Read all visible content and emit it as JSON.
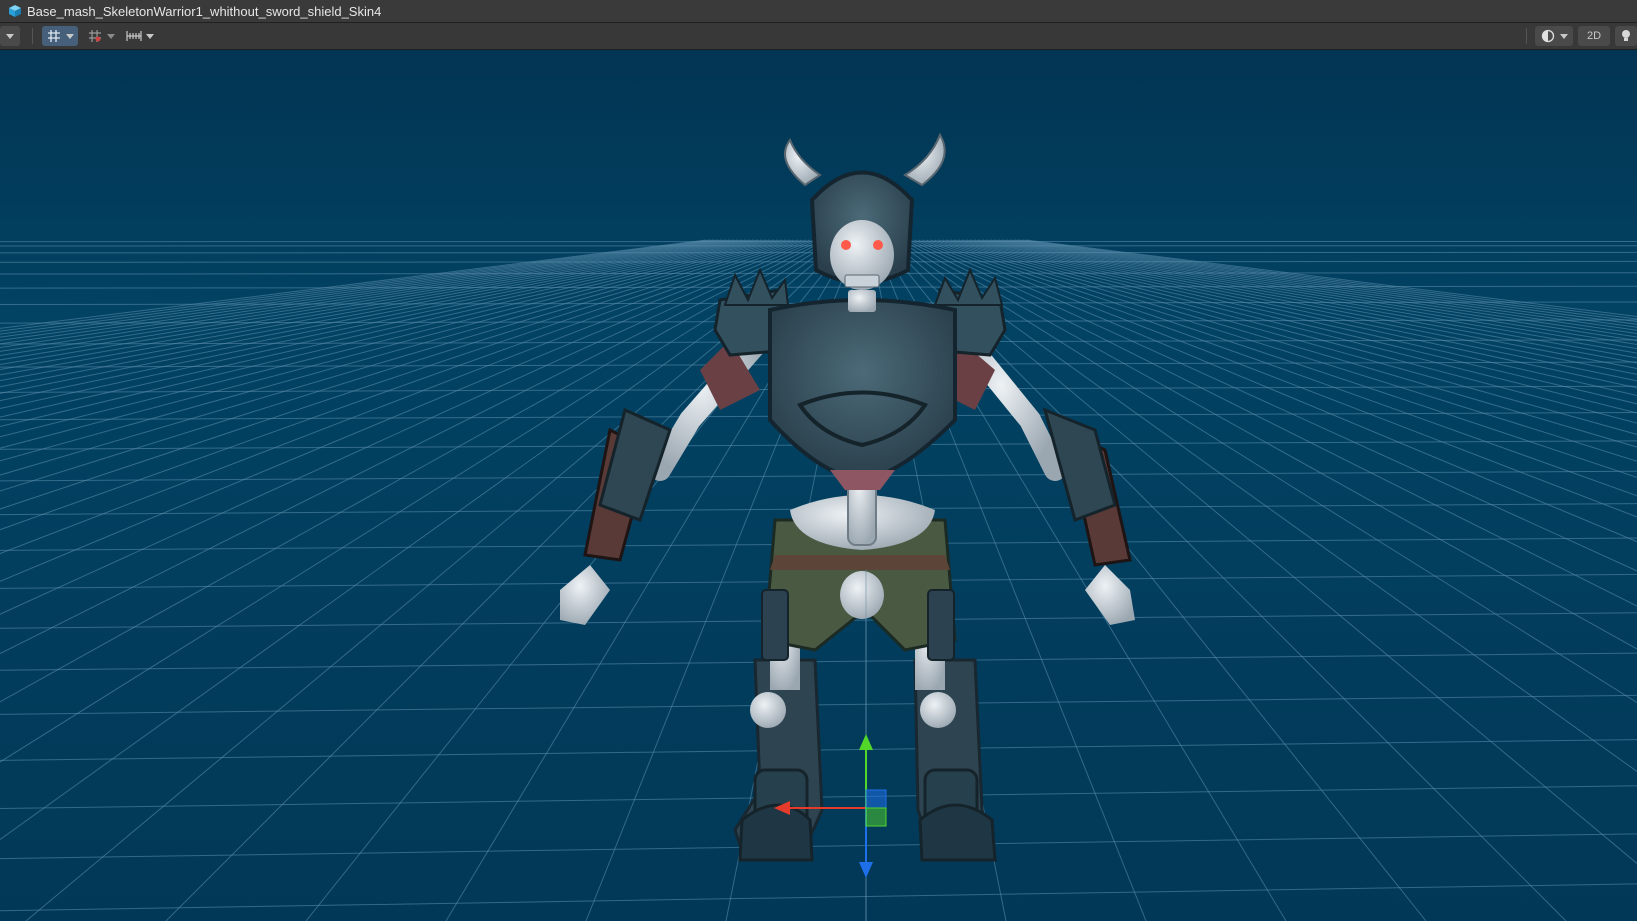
{
  "window": {
    "title": "Base_mash_SkeletonWarrior1_whithout_sword_shield_Skin4"
  },
  "toolbar": {
    "label_2d": "2D",
    "icons": [
      "tool-dropdown-icon",
      "grid-snap-icon",
      "increment-snap-icon",
      "ruler-icon",
      "shading-mode-icon",
      "lighting-icon"
    ]
  },
  "viewport": {
    "background_color": "#023755",
    "grid_color": "#5f8fae",
    "gizmo": {
      "x_axis_color": "#e53b2b",
      "y_axis_color": "#52d62a",
      "z_axis_color": "#1f6fe8"
    }
  }
}
